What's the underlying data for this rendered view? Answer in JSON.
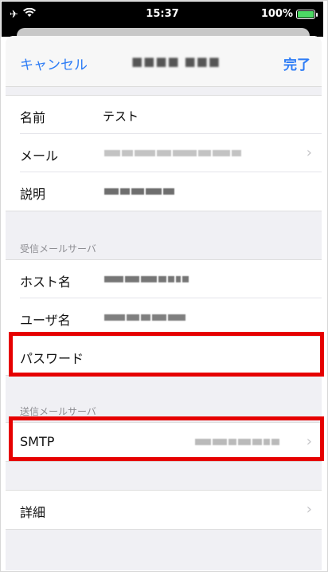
{
  "status_bar": {
    "time": "15:37",
    "battery": "100%",
    "left_icons": [
      "airplane-icon",
      "wifi-icon"
    ]
  },
  "nav": {
    "cancel_label": "キャンセル",
    "title": "",
    "done_label": "完了"
  },
  "account_section": {
    "header_cut": "",
    "rows": [
      {
        "label": "名前",
        "value": "テスト"
      },
      {
        "label": "メール",
        "value": ""
      },
      {
        "label": "説明",
        "value": ""
      }
    ]
  },
  "incoming_section": {
    "header": "受信メールサーバ",
    "rows": [
      {
        "label": "ホスト名",
        "value": ""
      },
      {
        "label": "ユーザ名",
        "value": ""
      },
      {
        "label": "パスワード",
        "value": ""
      }
    ]
  },
  "outgoing_section": {
    "header": "送信メールサーバ",
    "rows": [
      {
        "label": "SMTP",
        "value": ""
      }
    ]
  },
  "advanced_section": {
    "rows": [
      {
        "label": "詳細"
      }
    ]
  },
  "colors": {
    "accent": "#2d7cf6",
    "highlight": "#e60000",
    "battery": "#4cd964"
  }
}
